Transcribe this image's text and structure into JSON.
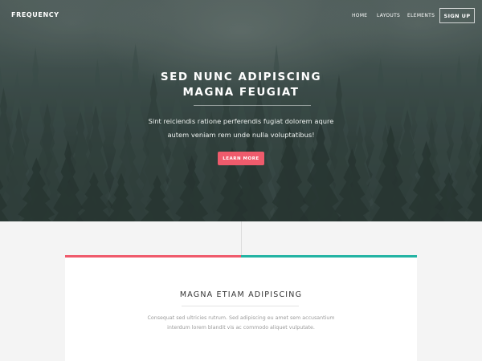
{
  "nav": {
    "brand": "FREQUENCY",
    "links": [
      "HOME",
      "LAYOUTS",
      "ELEMENTS"
    ],
    "cta": "SIGN UP"
  },
  "hero": {
    "title_line1": "SED NUNC ADIPISCING",
    "title_line2": "MAGNA FEUGIAT",
    "text_line1": "Sint reiciendis ratione perferendis fugiat dolorem aqure",
    "text_line2": "autem veniam rem unde nulla voluptatibus!",
    "button": "LEARN MORE"
  },
  "feature": {
    "title": "MAGNA ETIAM ADIPISCING",
    "text_line1": "Consequat sed ultricies rutrum. Sed adipiscing eu amet sem accusantium",
    "text_line2": "interdum lorem blandit vis ac commodo aliquet vulputate."
  },
  "colors": {
    "accent_pink": "#ef5b6c",
    "accent_teal": "#23b3a3"
  }
}
